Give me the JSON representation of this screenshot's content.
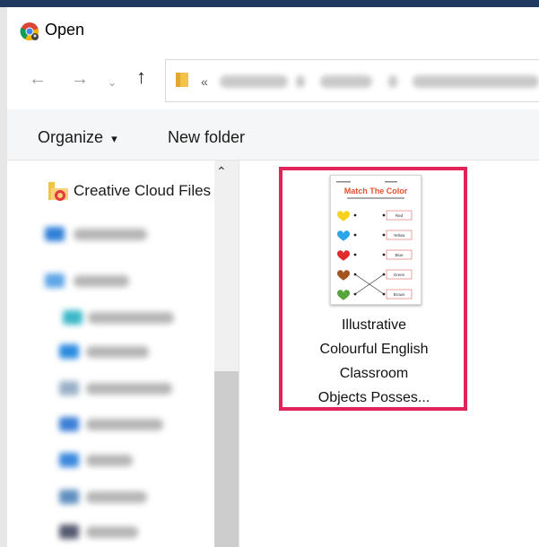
{
  "window": {
    "title": "Open"
  },
  "nav": {
    "back": "←",
    "forward": "→",
    "recent": "⌄",
    "up": "↑",
    "address_chevron": "«"
  },
  "toolbar": {
    "organize_label": "Organize",
    "organize_caret": "▾",
    "new_folder_label": "New folder"
  },
  "sidebar": {
    "items": [
      {
        "label": "Creative Cloud Files",
        "icon": "creative-cloud-folder-icon"
      }
    ],
    "scroll_up": "⌃"
  },
  "files": [
    {
      "name_lines": [
        "Illustrative",
        "Colourful English",
        "Classroom",
        "Objects Posses..."
      ],
      "icon": "worksheet-thumbnail",
      "selected": true,
      "thumbnail": {
        "title": "Match The Color",
        "words": [
          "Red",
          "Yellow",
          "Blue",
          "Green",
          "Brown"
        ],
        "heart_colors": [
          "#f6d21b",
          "#2aa6e8",
          "#e12a2a",
          "#a5551f",
          "#56a63b"
        ]
      }
    }
  ],
  "colors": {
    "selection_border": "#e0245a",
    "title_bar_top": "#1f3a5c"
  }
}
